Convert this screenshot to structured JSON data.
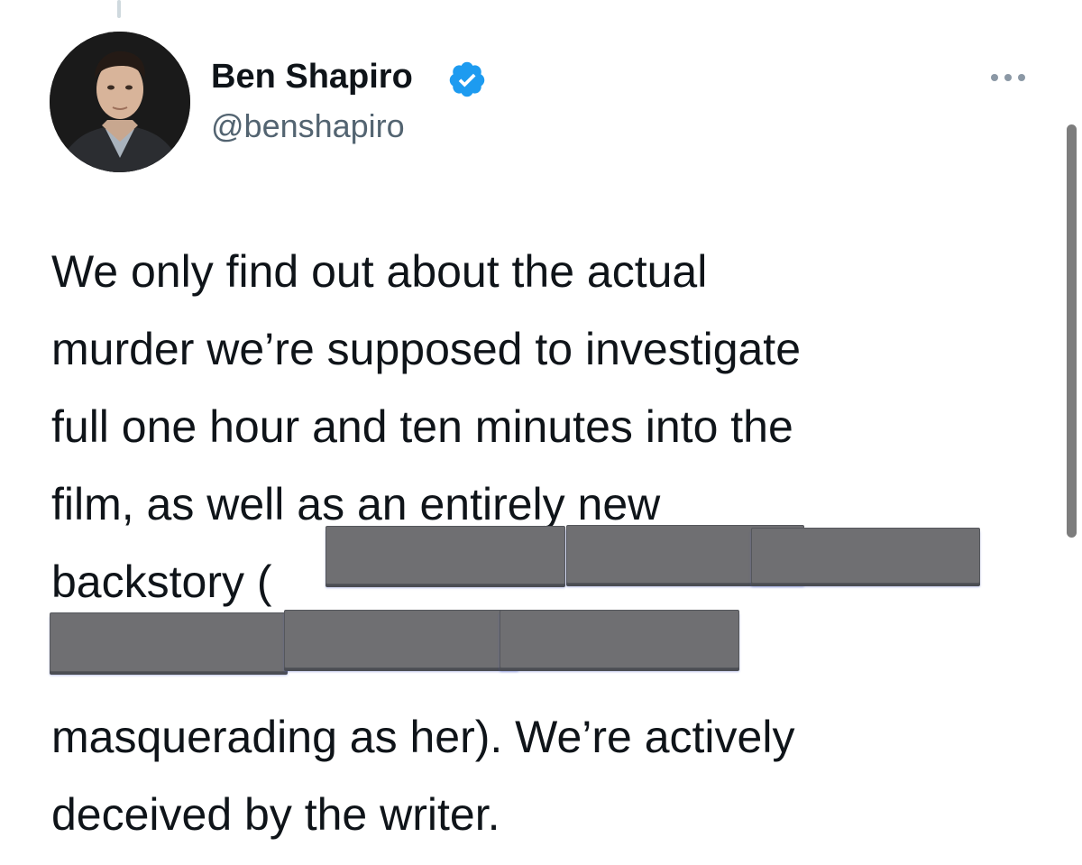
{
  "tweet": {
    "author": {
      "display_name": "Ben Shapiro",
      "handle": "@benshapiro",
      "verified": true,
      "avatar_icon": "profile-photo"
    },
    "more_icon": "more-options-icon",
    "text_lines": [
      "We only find out about the actual",
      "murder we’re supposed to investigate",
      "full one hour and ten minutes into the",
      "film, as well as an entirely new",
      "backstory (",
      "",
      "masquerading as her). We’re actively",
      "deceived by the writer."
    ],
    "redacted_segments": 6
  },
  "colors": {
    "text": "#0f1419",
    "secondary_text": "#536471",
    "verified_blue": "#1d9bf0",
    "redaction": "#6f6f72"
  }
}
